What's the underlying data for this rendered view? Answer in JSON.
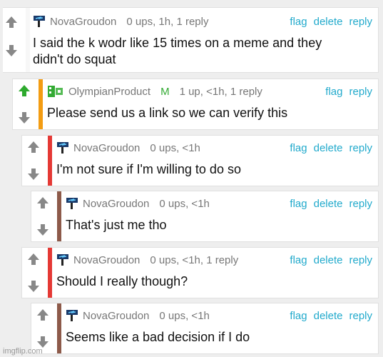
{
  "comments": [
    {
      "username": "NovaGroudon",
      "badge": "",
      "meta": "0 ups, 1h, 1 reply",
      "text_line1": "I said the k wodr like 15 times on a meme and they",
      "text_line2": "didn't do squat",
      "actions": [
        "flag",
        "delete",
        "reply"
      ],
      "bar_color": "",
      "upvoted": false
    },
    {
      "username": "OlympianProduct",
      "badge": "M",
      "meta": "1 up, <1h, 1 reply",
      "text_line1": "Please send us a link so we can verify this",
      "text_line2": "",
      "actions": [
        "flag",
        "reply"
      ],
      "bar_color": "#f39c12",
      "upvoted": true
    },
    {
      "username": "NovaGroudon",
      "badge": "",
      "meta": "0 ups, <1h",
      "text_line1": "I'm not sure if I'm willing to do so",
      "text_line2": "",
      "actions": [
        "flag",
        "delete",
        "reply"
      ],
      "bar_color": "#e53935",
      "upvoted": false
    },
    {
      "username": "NovaGroudon",
      "badge": "",
      "meta": "0 ups, <1h",
      "text_line1": "That's just me tho",
      "text_line2": "",
      "actions": [
        "flag",
        "delete",
        "reply"
      ],
      "bar_color": "#8d5a4a",
      "upvoted": false
    },
    {
      "username": "NovaGroudon",
      "badge": "",
      "meta": "0 ups, <1h, 1 reply",
      "text_line1": "Should I really though?",
      "text_line2": "",
      "actions": [
        "flag",
        "delete",
        "reply"
      ],
      "bar_color": "#e53935",
      "upvoted": false
    },
    {
      "username": "NovaGroudon",
      "badge": "",
      "meta": "0 ups, <1h",
      "text_line1": "Seems like a bad decision if I do",
      "text_line2": "",
      "actions": [
        "flag",
        "delete",
        "reply"
      ],
      "bar_color": "#8d5a4a",
      "upvoted": false
    }
  ],
  "colors": {
    "link": "#22aacc",
    "upvote_active": "#2eaa2e",
    "arrow_inactive": "#888888"
  },
  "watermark": "imgflip.com"
}
